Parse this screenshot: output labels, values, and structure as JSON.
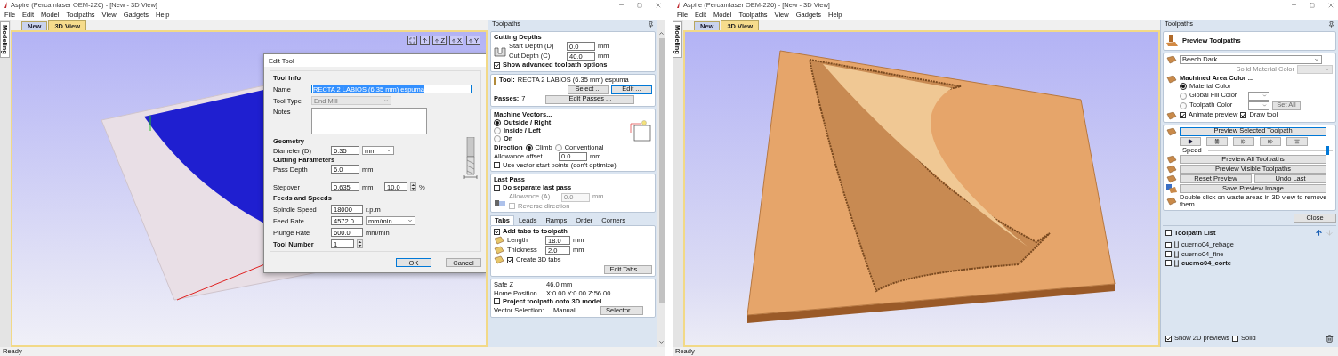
{
  "left_window": {
    "title": "Aspire (Percamlaser OEM-226) - [New - 3D View]",
    "menu": [
      "File",
      "Edit",
      "Model",
      "Toolpaths",
      "View",
      "Gadgets",
      "Help"
    ],
    "side_tab": "Modeling",
    "doc_tabs": [
      {
        "label": "New",
        "selected": false
      },
      {
        "label": "3D View",
        "selected": true
      }
    ],
    "view_axes": [
      "Z",
      "X",
      "Y"
    ],
    "status": "Ready"
  },
  "edit_tool_dialog": {
    "title": "Edit Tool",
    "tool_info": "Tool Info",
    "name_label": "Name",
    "name": "RECTA 2 LABIOS (6.35 mm) espuma",
    "type_label": "Tool Type",
    "type": "End Mill",
    "notes_label": "Notes",
    "geometry": "Geometry",
    "diameter_label": "Diameter (D)",
    "diameter": "6.35",
    "diameter_unit": "mm",
    "cutting": "Cutting Parameters",
    "pass_label": "Pass Depth",
    "pass": "6.0",
    "pass_unit": "mm",
    "stepover_label": "Stepover",
    "stepover": "0.635",
    "stepover_unit": "mm",
    "stepover_pct": "10.0",
    "pct": "%",
    "feeds": "Feeds and Speeds",
    "spindle_label": "Spindle Speed",
    "spindle": "18000",
    "spindle_unit": "r.p.m",
    "feed_label": "Feed Rate",
    "feed": "4572.0",
    "feed_unit": "mm/min",
    "plunge_label": "Plunge Rate",
    "plunge": "600.0",
    "plunge_unit": "mm/min",
    "number_label": "Tool Number",
    "number": "1",
    "ok": "OK",
    "cancel": "Cancel"
  },
  "left_panel": {
    "title": "Toolpaths",
    "cutting_depths": {
      "heading": "Cutting Depths",
      "start_label": "Start Depth (D)",
      "start_value": "0.0",
      "start_unit": "mm",
      "cut_label": "Cut Depth (C)",
      "cut_value": "40.0",
      "cut_unit": "mm",
      "advanced": {
        "label": "Show advanced toolpath options",
        "checked": true
      }
    },
    "tool": {
      "label": "Tool:",
      "name": "RECTA 2 LABIOS (6.35 mm) espuma",
      "buttons": [
        "Select ...",
        "Edit ..."
      ]
    },
    "passes": {
      "label": "Passes:",
      "value": "7",
      "button": "Edit Passes ..."
    },
    "machine_vectors": {
      "heading": "Machine Vectors...",
      "options": [
        {
          "label": "Outside / Right",
          "selected": true
        },
        {
          "label": "Inside / Left",
          "selected": false
        },
        {
          "label": "On",
          "selected": false
        }
      ],
      "direction_label": "Direction",
      "directions": [
        {
          "label": "Climb",
          "selected": true
        },
        {
          "label": "Conventional",
          "selected": false
        }
      ],
      "allowance_label": "Allowance offset",
      "allowance_value": "0.0",
      "allowance_unit": "mm",
      "start_points": {
        "label": "Use vector start points (don't optimize)",
        "checked": false
      }
    },
    "last_pass": {
      "heading": "Last Pass",
      "separate": {
        "label": "Do separate last pass",
        "checked": false
      },
      "allowance_label": "Allowance (A)",
      "allowance_value": "0.0",
      "allowance_unit": "mm",
      "reverse": {
        "label": "Reverse direction",
        "checked": false
      }
    },
    "tabs": [
      {
        "label": "Tabs",
        "selected": true
      },
      {
        "label": "Leads",
        "selected": false
      },
      {
        "label": "Ramps",
        "selected": false
      },
      {
        "label": "Order",
        "selected": false
      },
      {
        "label": "Corners",
        "selected": false
      }
    ],
    "tab_options": {
      "add": {
        "label": "Add tabs to toolpath",
        "checked": true
      },
      "length_label": "Length",
      "length_value": "18.0",
      "length_unit": "mm",
      "thickness_label": "Thickness",
      "thickness_value": "2.0",
      "thickness_unit": "mm",
      "create_3d": {
        "label": "Create 3D tabs",
        "checked": true
      },
      "button": "Edit Tabs ...."
    },
    "summary": {
      "safe_z_label": "Safe Z",
      "safe_z": "46.0 mm",
      "home_label": "Home Position",
      "home": "X:0.00 Y:0.00 Z:56.00",
      "project": {
        "label": "Project toolpath onto 3D model",
        "checked": false
      },
      "vector_label": "Vector Selection:",
      "vector_value": "Manual",
      "button": "Selector ..."
    }
  },
  "right_window": {
    "title": "Aspire (Percamlaser OEM-226) - [New - 3D View]",
    "menu": [
      "File",
      "Edit",
      "Model",
      "Toolpaths",
      "View",
      "Gadgets",
      "Help"
    ],
    "side_tab": "Modeling",
    "doc_tabs": [
      {
        "label": "New",
        "selected": false
      },
      {
        "label": "3D View",
        "selected": true
      }
    ],
    "status": "Ready"
  },
  "right_panel": {
    "title": "Toolpaths",
    "heading": "Preview Toolpaths",
    "material": "Beech Dark",
    "solid_color_label": "Solid Material Color",
    "machined_heading": "Machined Area Color ...",
    "color_options": [
      {
        "label": "Material Color",
        "selected": true
      },
      {
        "label": "Global Fill Color",
        "selected": false
      },
      {
        "label": "Toolpath Color",
        "selected": false
      }
    ],
    "set_all": "Set All",
    "animate": {
      "label": "Animate preview",
      "checked": true
    },
    "draw_tool": {
      "label": "Draw tool",
      "checked": true
    },
    "preview_selected": "Preview Selected Toolpath",
    "speed": {
      "label": "Speed",
      "level": 0.97
    },
    "preview_all": "Preview All Toolpaths",
    "preview_visible": "Preview Visible Toolpaths",
    "reset": "Reset Preview",
    "undo": "Undo Last",
    "save": "Save Preview Image",
    "hint": "Double click on waste areas in 3D view to remove them.",
    "close": "Close",
    "list": {
      "label": "Toolpath List",
      "checked": false,
      "items": [
        {
          "name": "cuerno04_rebage",
          "checked": false,
          "selected": false
        },
        {
          "name": "cuerno04_fine",
          "checked": false,
          "selected": false
        },
        {
          "name": "cuerno04_corte",
          "checked": false,
          "selected": true
        }
      ],
      "show_2d": {
        "label": "Show 2D previews",
        "checked": true
      },
      "solid": {
        "label": "Solid",
        "checked": false
      }
    }
  }
}
